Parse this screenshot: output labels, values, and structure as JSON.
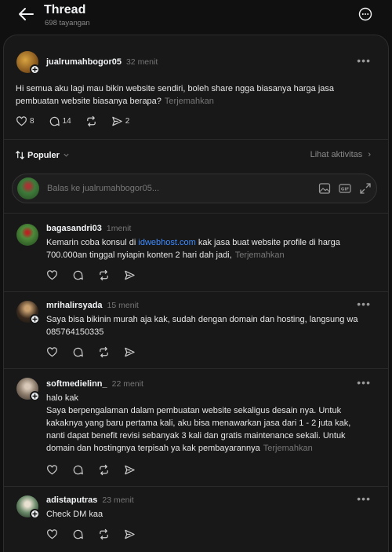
{
  "header": {
    "title": "Thread",
    "views": "698 tayangan"
  },
  "post": {
    "username": "jualrumahbogor05",
    "time": "32 menit",
    "text": "Hi semua aku lagi mau bikin website sendiri, boleh share ngga biasanya harga jasa pembuatan website biasanya berapa?",
    "translate": "Terjemahkan",
    "likes": "8",
    "comments": "14",
    "shares": "2"
  },
  "sort": {
    "label": "Populer",
    "activity": "Lihat aktivitas"
  },
  "reply_box": {
    "placeholder": "Balas ke jualrumahbogor05..."
  },
  "replies": [
    {
      "username": "bagasandri03",
      "time": "1menit",
      "text_before": "Kemarin coba konsul di ",
      "link": "idwebhost.com",
      "text_after": " kak jasa buat website profile di harga 700.000an tinggal nyiapin konten 2 hari dah jadi,",
      "translate": "Terjemahkan"
    },
    {
      "username": "mrihalirsyada",
      "time": "15 menit",
      "text": "Saya bisa bikinin murah aja kak, sudah dengan domain dan hosting, langsung wa 085764150335"
    },
    {
      "username": "softmedielinn_",
      "time": "22 menit",
      "line1": "halo kak",
      "text": "Saya berpengalaman dalam pembuatan website sekaligus desain nya. Untuk kakaknya yang baru pertama kali, aku bisa menawarkan jasa dari 1 - 2 juta kak, nanti dapat benefit revisi sebanyak 3 kali dan gratis maintenance sekali. Untuk domain dan hostingnya terpisah ya kak pembayarannya",
      "translate": "Terjemahkan"
    },
    {
      "username": "adistaputras",
      "time": "23 menit",
      "text": "Check DM kaa"
    }
  ],
  "colors": {
    "background": "#101010",
    "card": "#181818",
    "link": "#3d8bff",
    "muted": "#777777"
  }
}
